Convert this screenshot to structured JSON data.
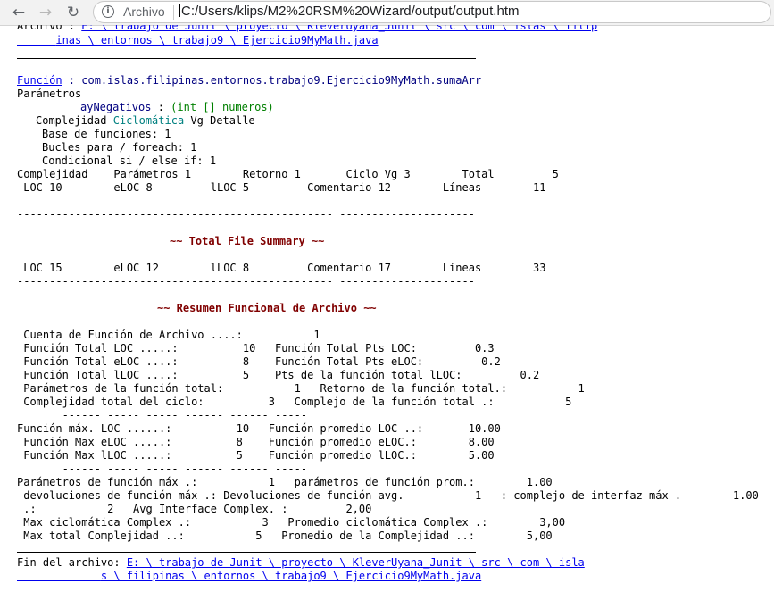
{
  "browser": {
    "back_glyph": "←",
    "forward_glyph": "→",
    "reload_glyph": "↻",
    "info_glyph": "i",
    "protocol_label": "Archivo",
    "url": "C:/Users/klips/M2%20RSM%20Wizard/output/output.htm"
  },
  "doc": {
    "head_label": "Archivo : ",
    "head_path_1": "E: \\ trabajo de Junit \\ proyecto \\ KleverUyana_Junit \\ src \\ com \\ islas \\ filip",
    "head_path_2": "inas \\ entornos \\ trabajo9 \\ Ejercicio9MyMath.java",
    "func_label": "Función",
    "func_name": " : com.islas.filipinas.entornos.trabajo9.Ejercicio9MyMath.sumaArr",
    "params_label": "Parámetros",
    "param_name": "ayNegativos",
    "param_sep": " : ",
    "param_type": "(int [] numeros)",
    "cc_title_a": "Complejidad ",
    "cc_title_b": "Ciclomática",
    "cc_title_c": " Vg Detalle",
    "cc_base": "Base de funciones: 1",
    "cc_loops": "Bucles para / foreach: 1",
    "cc_cond": "Condicional si / else if: 1",
    "complexity_row": "Complejidad    Parámetros 1        Retorno 1       Ciclo Vg 3        Total         5",
    "loc_row_1": " LOC 10        eLOC 8         lLOC 5         Comentario 12        Líneas        11",
    "dashes_1": "------------------------------------------------- ---------------------",
    "total_summary_title": "~~ Total File Summary ~~",
    "loc_row_2": " LOC 15        eLOC 12        lLOC 8         Comentario 17        Líneas        33",
    "dashes_2": "------------------------------------------------- ---------------------",
    "func_summary_title": "~~ Resumen Funcional de Archivo ~~",
    "s1": " Cuenta de Función de Archivo ....:           1",
    "s2": " Función Total LOC .....:          10   Función Total Pts LOC:         0.3",
    "s3": " Función Total eLOC ....:          8    Función Total Pts eLOC:         0.2",
    "s4": " Función Total lLOC ....:          5    Pts de la función total lLOC:         0.2",
    "s5": " Parámetros de la función total:           1   Retorno de la función total.:           1",
    "s6": " Complejidad total del ciclo:          3   Complejo de la función total .:           5",
    "s7": "       ------ ----- ----- ------ ------ -----",
    "s8": "Función máx. LOC ......:          10   Función promedio LOC ..:       10.00",
    "s9": " Función Max eLOC .....:          8    Función promedio eLOC.:        8.00",
    "s10": " Función Max lLOC .....:          5    Función promedio lLOC.:        5.00",
    "s11": "       ------ ----- ----- ------ ------ -----",
    "s12": "Parámetros de función máx .:           1   parámetros de función prom.:        1.00",
    "s13": " devoluciones de función máx .: Devoluciones de función avg.           1   : complejo de interfaz máx .        1.00",
    "s14": " .:           2   Avg Interface Complex. :         2,00",
    "s15": " Max ciclomática Complex .:           3   Promedio ciclomática Complex .:        3,00",
    "s16": " Max total Complejidad ..:           5   Promedio de la Complejidad ..:        5,00",
    "foot_label": "Fin del archivo: ",
    "foot_path_1": "E: \\ trabajo de Junit \\ proyecto \\ KleverUyana_Junit \\ src \\ com \\ isla",
    "foot_path_2": "s \\ filipinas \\ entornos \\ trabajo9 \\ Ejercicio9MyMath.java"
  }
}
